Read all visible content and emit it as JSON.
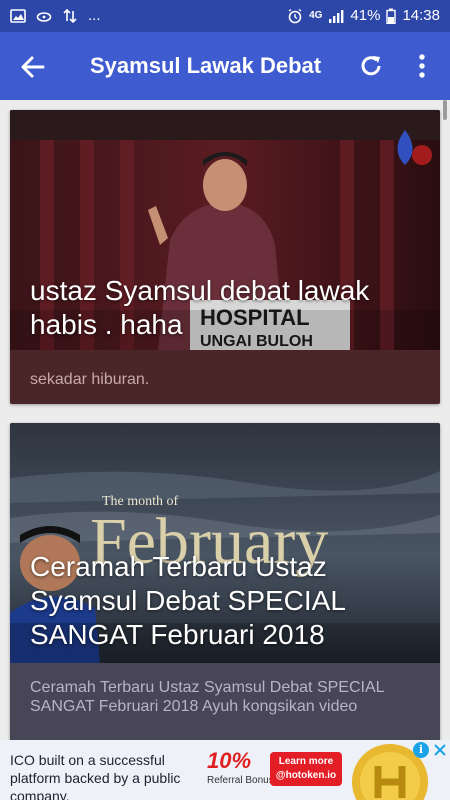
{
  "status_bar": {
    "dots": "...",
    "network": "4G",
    "battery": "41%",
    "time": "14:38"
  },
  "app_bar": {
    "title": "Syamsul Lawak Debat"
  },
  "cards": [
    {
      "title": "ustaz Syamsul debat lawak habis . haha",
      "description": "sekadar hiburan.",
      "thumb_sign": "HOSPITAL",
      "thumb_sign2": "UNGAI BULOH"
    },
    {
      "title": "Ceramah Terbaru Ustaz Syamsul Debat SPECIAL SANGAT Februari 2018",
      "description": "Ceramah Terbaru Ustaz Syamsul Debat SPECIAL SANGAT Februari 2018 Ayuh kongsikan video",
      "thumb_top": "The month of",
      "thumb_word": "February"
    }
  ],
  "ad": {
    "text": "ICO built on a successful platform backed by a public company.",
    "percent": "10%",
    "referral": "Referral Bonus",
    "cta_line1": "Learn more",
    "cta_line2": "@hotoken.io",
    "info": "i"
  },
  "colors": {
    "status_bar": "#2d47a8",
    "app_bar": "#3f5bd0",
    "card1_bg": "#4a2628",
    "card2_bg": "#484556"
  }
}
